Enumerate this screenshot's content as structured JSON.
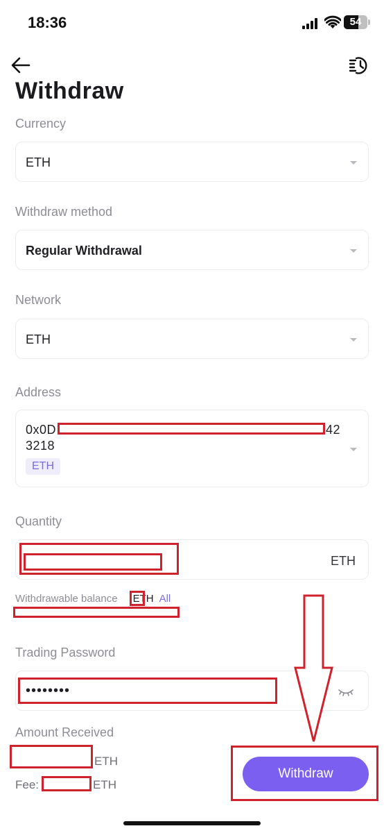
{
  "status_bar": {
    "time": "18:36",
    "battery": "54"
  },
  "header": {
    "title": "Withdraw",
    "back_icon": "arrow-left-icon",
    "history_icon": "history-icon"
  },
  "form": {
    "currency": {
      "label": "Currency",
      "value": "ETH"
    },
    "method": {
      "label": "Withdraw method",
      "value": "Regular Withdrawal"
    },
    "network": {
      "label": "Network",
      "value": "ETH"
    },
    "address": {
      "label": "Address",
      "line1_prefix": "0x0D",
      "line1_suffix": "42",
      "line2": "3218",
      "chip": "ETH"
    },
    "quantity": {
      "label": "Quantity",
      "unit": "ETH"
    },
    "balance": {
      "label": "Withdrawable balance",
      "unit": "ETH",
      "all_label": "All"
    },
    "password": {
      "label": "Trading Password",
      "value": "••••••••"
    },
    "received": {
      "label": "Amount Received",
      "unit": "ETH"
    },
    "fee": {
      "label": "Fee:",
      "unit": "ETH"
    }
  },
  "actions": {
    "withdraw_label": "Withdraw"
  },
  "colors": {
    "accent": "#7a5ff0",
    "annotation": "#d0222c"
  }
}
